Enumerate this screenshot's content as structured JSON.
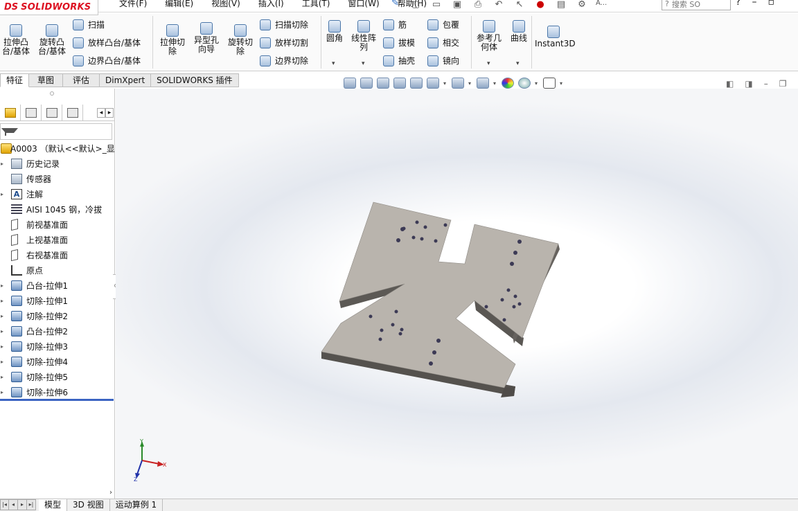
{
  "app": {
    "logo_ds": "DS",
    "logo_name": "SOLIDWORKS"
  },
  "menu": [
    "文件(F)",
    "编辑(E)",
    "视图(V)",
    "插入(I)",
    "工具(T)",
    "窗口(W)",
    "帮助(H)"
  ],
  "quick_access": {
    "truncated_label": "A...",
    "search_placeholder": "搜索 SO"
  },
  "ribbon": {
    "large": [
      {
        "label": "拉伸凸\n台/基体",
        "icon": "extruded-boss-icon"
      },
      {
        "label": "旋转凸\n台/基体",
        "icon": "revolved-boss-icon"
      },
      {
        "label": "拉伸切\n除",
        "icon": "extruded-cut-icon"
      },
      {
        "label": "异型孔\n向导",
        "icon": "hole-wizard-icon"
      },
      {
        "label": "旋转切\n除",
        "icon": "revolved-cut-icon"
      },
      {
        "label": "圆角",
        "icon": "fillet-icon"
      },
      {
        "label": "线性阵\n列",
        "icon": "linear-pattern-icon"
      },
      {
        "label": "参考几\n何体",
        "icon": "reference-geometry-icon"
      },
      {
        "label": "曲线",
        "icon": "curves-icon"
      },
      {
        "label": "Instant3D",
        "icon": "instant3d-icon"
      }
    ],
    "small": [
      {
        "label": "扫描",
        "icon": "swept-boss-icon"
      },
      {
        "label": "放样凸台/基体",
        "icon": "lofted-boss-icon"
      },
      {
        "label": "边界凸台/基体",
        "icon": "boundary-boss-icon"
      },
      {
        "label": "扫描切除",
        "icon": "swept-cut-icon"
      },
      {
        "label": "放样切割",
        "icon": "lofted-cut-icon"
      },
      {
        "label": "边界切除",
        "icon": "boundary-cut-icon"
      },
      {
        "label": "筋",
        "icon": "rib-icon"
      },
      {
        "label": "拔模",
        "icon": "draft-icon"
      },
      {
        "label": "抽壳",
        "icon": "shell-icon"
      },
      {
        "label": "包覆",
        "icon": "wrap-icon"
      },
      {
        "label": "相交",
        "icon": "intersect-icon"
      },
      {
        "label": "镜向",
        "icon": "mirror-icon"
      }
    ]
  },
  "cm_tabs": [
    "特征",
    "草图",
    "评估",
    "DimXpert",
    "SOLIDWORKS 插件"
  ],
  "cm_active": "特征",
  "tree": {
    "root": "A0003 （默认<<默认>_显示",
    "items": [
      {
        "label": "历史记录",
        "icon": "history-folder-icon",
        "type": "folder",
        "expand": true
      },
      {
        "label": "传感器",
        "icon": "sensor-icon",
        "type": "folder",
        "expand": false
      },
      {
        "label": "注解",
        "icon": "annotation-icon",
        "type": "note",
        "expand": true
      },
      {
        "label": "AISI 1045 钢，冷拔",
        "icon": "material-icon",
        "type": "material",
        "expand": false
      },
      {
        "label": "前视基准面",
        "icon": "plane-icon",
        "type": "plane",
        "expand": false
      },
      {
        "label": "上视基准面",
        "icon": "plane-icon",
        "type": "plane",
        "expand": false
      },
      {
        "label": "右视基准面",
        "icon": "plane-icon",
        "type": "plane",
        "expand": false
      },
      {
        "label": "原点",
        "icon": "origin-icon",
        "type": "origin",
        "expand": false
      },
      {
        "label": "凸台-拉伸1",
        "icon": "boss-extrude-icon",
        "type": "feat",
        "expand": true
      },
      {
        "label": "切除-拉伸1",
        "icon": "cut-extrude-icon",
        "type": "feat",
        "expand": true
      },
      {
        "label": "切除-拉伸2",
        "icon": "cut-extrude-icon",
        "type": "feat",
        "expand": true
      },
      {
        "label": "凸台-拉伸2",
        "icon": "boss-extrude-icon",
        "type": "feat",
        "expand": true
      },
      {
        "label": "切除-拉伸3",
        "icon": "cut-extrude-icon",
        "type": "feat",
        "expand": true
      },
      {
        "label": "切除-拉伸4",
        "icon": "cut-extrude-icon",
        "type": "feat",
        "expand": true
      },
      {
        "label": "切除-拉伸5",
        "icon": "cut-extrude-icon",
        "type": "feat",
        "expand": true
      },
      {
        "label": "切除-拉伸6",
        "icon": "cut-extrude-icon",
        "type": "feat",
        "expand": true
      }
    ]
  },
  "triad": {
    "y": "Y",
    "x": "X",
    "z": "Z"
  },
  "bottom_tabs": [
    "模型",
    "3D 视图",
    "运动算例 1"
  ],
  "bottom_active": "模型",
  "colors": {
    "accent": "#3b64c2",
    "brand_red": "#dd1122",
    "part_face": "#b9b4ad",
    "part_side": "#5a5753"
  }
}
